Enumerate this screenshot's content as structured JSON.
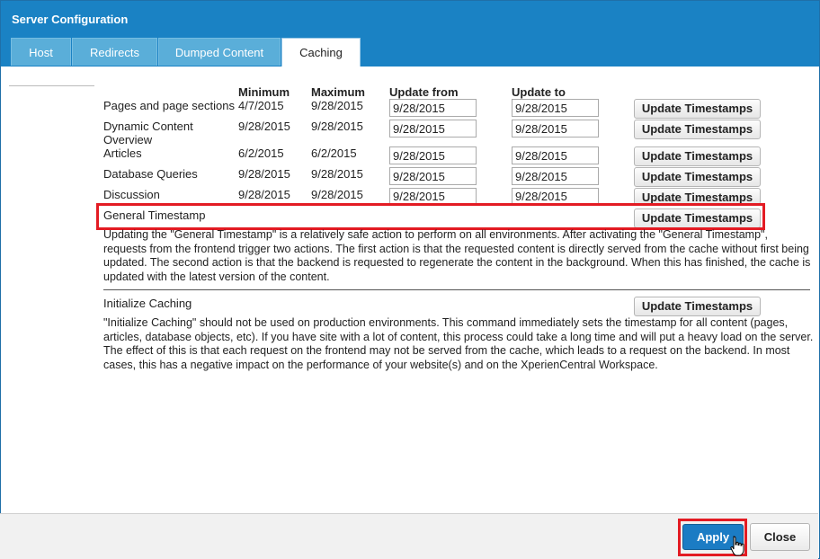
{
  "dialog": {
    "title": "Server Configuration"
  },
  "tabs": [
    {
      "label": "Host"
    },
    {
      "label": "Redirects"
    },
    {
      "label": "Dumped Content"
    },
    {
      "label": "Caching",
      "active": true
    }
  ],
  "table": {
    "headers": {
      "minimum": "Minimum",
      "maximum": "Maximum",
      "update_from": "Update from",
      "update_to": "Update to"
    },
    "rows": [
      {
        "label": "Pages and page sections",
        "min": "4/7/2015",
        "max": "9/28/2015",
        "from": "9/28/2015",
        "to": "9/28/2015",
        "button": "Update Timestamps"
      },
      {
        "label": "Dynamic Content Overview",
        "min": "9/28/2015",
        "max": "9/28/2015",
        "from": "9/28/2015",
        "to": "9/28/2015",
        "button": "Update Timestamps"
      },
      {
        "label": "Articles",
        "min": "6/2/2015",
        "max": "6/2/2015",
        "from": "9/28/2015",
        "to": "9/28/2015",
        "button": "Update Timestamps"
      },
      {
        "label": "Database Queries",
        "min": "9/28/2015",
        "max": "9/28/2015",
        "from": "9/28/2015",
        "to": "9/28/2015",
        "button": "Update Timestamps"
      },
      {
        "label": "Discussion",
        "min": "9/28/2015",
        "max": "9/28/2015",
        "from": "9/28/2015",
        "to": "9/28/2015",
        "button": "Update Timestamps"
      }
    ]
  },
  "general_timestamp": {
    "label": "General Timestamp",
    "button": "Update Timestamps",
    "description": "Updating the \"General Timestamp\" is a relatively safe action to perform on all environments. After activating the \"General Timestamp\", requests from the frontend trigger two actions. The first action is that the requested content is directly served from the cache without first being updated. The second action is that the backend is requested to regenerate the content in the background. When this has finished, the cache is updated with the latest version of the content."
  },
  "initialize_caching": {
    "label": "Initialize Caching",
    "button": "Update Timestamps",
    "description": "\"Initialize Caching\" should not be used on production environments. This command immediately sets the timestamp for all content (pages, articles, database objects, etc). If you have site with a lot of content, this process could take a long time and will put a heavy load on the server. The effect of this is that each request on the frontend may not be served from the cache, which leads to a request on the backend. In most cases, this has a negative impact on the performance of your website(s) and on the XperienCentral Workspace."
  },
  "footer": {
    "apply_label": "Apply",
    "close_label": "Close"
  },
  "colors": {
    "header_blue": "#1a82c4",
    "tab_blue": "#5aaed9",
    "highlight_red": "#e31b23",
    "apply_blue": "#1b7cc4"
  },
  "icons": {
    "cursor": "hand-pointer-icon"
  }
}
